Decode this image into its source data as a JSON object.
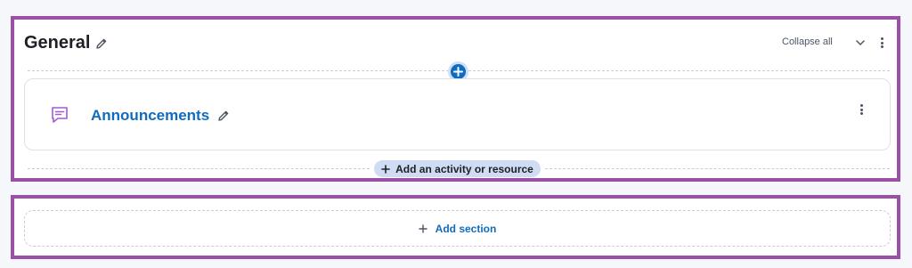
{
  "section": {
    "title": "General",
    "collapse_label": "Collapse all"
  },
  "activity": {
    "name": "Announcements",
    "icon": "forum-chat-icon"
  },
  "add_activity_label": "Add an activity or resource",
  "add_section_label": "Add section",
  "colors": {
    "frame_highlight": "#9b4fa7",
    "link_blue": "#0f6cbf",
    "forum_icon_purple": "#a15bd6",
    "pill_background": "#cfdcf3"
  }
}
